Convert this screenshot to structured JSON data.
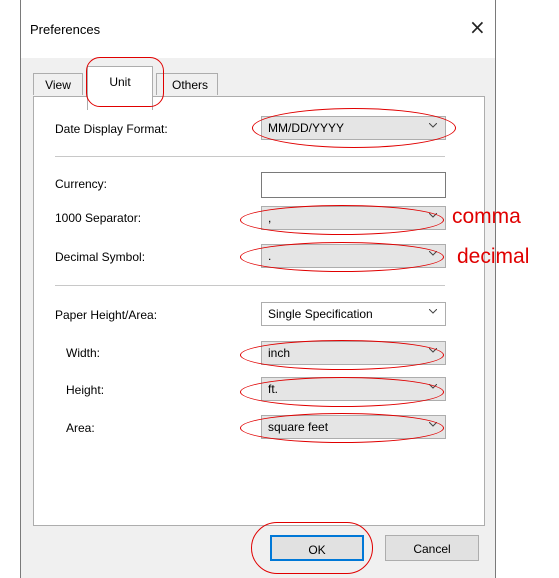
{
  "dialog": {
    "title": "Preferences",
    "close_glyph": "×"
  },
  "tabs": [
    {
      "label": "View",
      "selected": false
    },
    {
      "label": "Unit",
      "selected": true
    },
    {
      "label": "Others",
      "selected": false
    }
  ],
  "fields": {
    "date_display_format": {
      "label": "Date Display Format:",
      "value": "MM/DD/YYYY"
    },
    "currency": {
      "label": "Currency:",
      "value": ""
    },
    "thousand_separator": {
      "label": "1000 Separator:",
      "value": ","
    },
    "decimal_symbol": {
      "label": "Decimal Symbol:",
      "value": "."
    },
    "paper_height_area": {
      "label": "Paper Height/Area:",
      "value": "Single Specification"
    },
    "width": {
      "label": "Width:",
      "value": "inch"
    },
    "height": {
      "label": "Height:",
      "value": "ft."
    },
    "area": {
      "label": "Area:",
      "value": "square feet"
    }
  },
  "buttons": {
    "ok": "OK",
    "cancel": "Cancel"
  },
  "annotations": {
    "comma": "comma",
    "decimal": "decimal",
    "color": "#e00000"
  },
  "icons": {
    "dropdown": "chevron-down-icon",
    "close": "close-icon"
  }
}
